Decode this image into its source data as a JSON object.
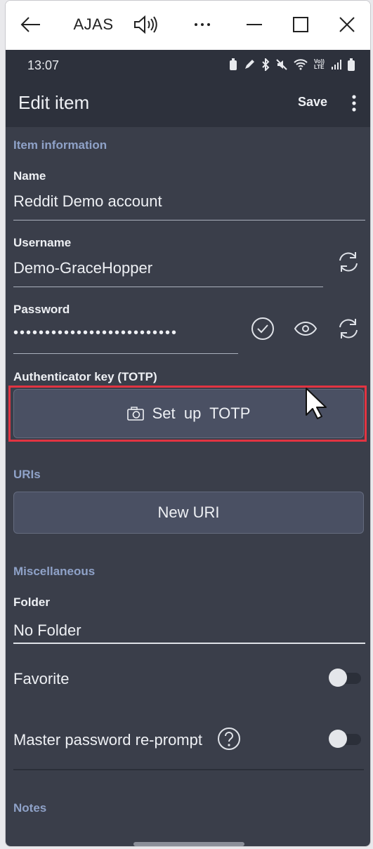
{
  "window": {
    "title": "AJAS",
    "icons": [
      "back-arrow-icon",
      "speaker-icon",
      "more-icon",
      "minimize-icon",
      "maximize-icon",
      "close-icon"
    ]
  },
  "status_bar": {
    "time": "13:07",
    "icons": [
      "battery-saver-icon",
      "pen-icon",
      "bluetooth-icon",
      "mute-icon",
      "wifi-icon",
      "volte-icon",
      "signal-icon",
      "battery-icon"
    ],
    "volte_label": "Vo)) LTE"
  },
  "app_bar": {
    "title": "Edit item",
    "save_label": "Save"
  },
  "item_information": {
    "section_title": "Item information",
    "name_label": "Name",
    "name_value": "Reddit Demo account",
    "username_label": "Username",
    "username_value": "Demo-GraceHopper",
    "password_label": "Password",
    "password_value": "••••••••••••••••••••••••••",
    "totp_label": "Authenticator key (TOTP)",
    "totp_button": "Set  up  TOTP"
  },
  "uris": {
    "section_title": "URIs",
    "new_uri_button": "New URI"
  },
  "miscellaneous": {
    "section_title": "Miscellaneous",
    "folder_label": "Folder",
    "folder_value": "No Folder",
    "favorite_label": "Favorite",
    "favorite_on": false,
    "reprompt_label": "Master password re-prompt",
    "reprompt_on": false
  },
  "notes": {
    "section_title": "Notes"
  },
  "colors": {
    "accent_section": "#8fa2c8",
    "background": "#3a3e4a",
    "highlight": "#e23442"
  }
}
